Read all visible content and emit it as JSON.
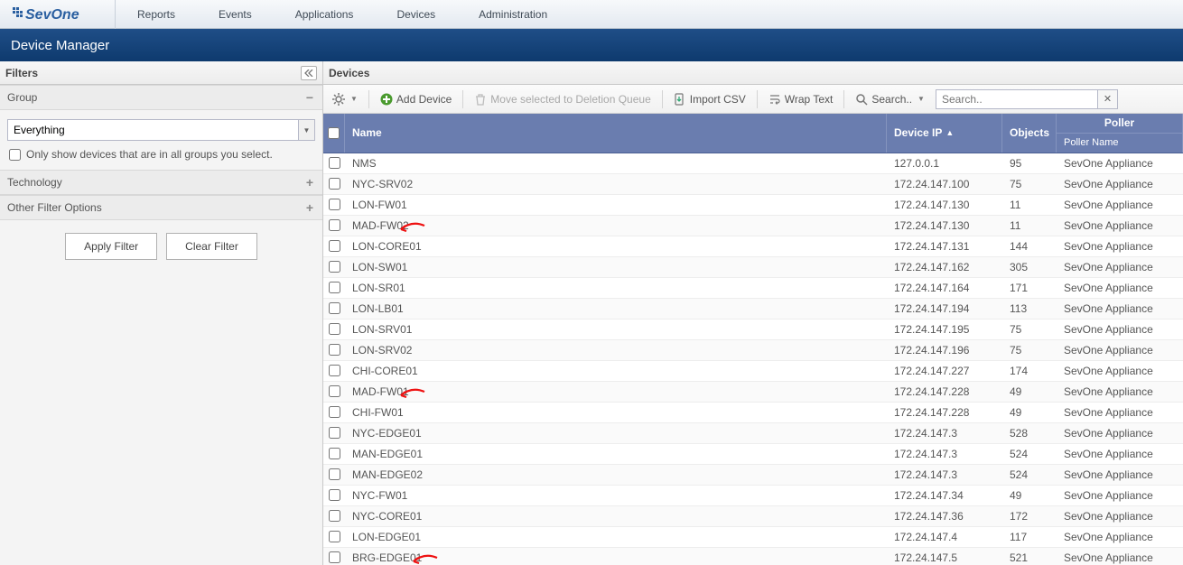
{
  "brand": "SevOne",
  "menu": {
    "items": [
      "Reports",
      "Events",
      "Applications",
      "Devices",
      "Administration"
    ]
  },
  "page_title": "Device Manager",
  "sidebar": {
    "title": "Filters",
    "sections": {
      "group": {
        "label": "Group",
        "combo_value": "Everything",
        "only_in_all_label": "Only show devices that are in all groups you select."
      },
      "technology": {
        "label": "Technology"
      },
      "other": {
        "label": "Other Filter Options"
      }
    },
    "apply_label": "Apply Filter",
    "clear_label": "Clear Filter"
  },
  "main": {
    "title": "Devices",
    "toolbar": {
      "add_device": "Add Device",
      "move_deletion": "Move selected to Deletion Queue",
      "import_csv": "Import CSV",
      "wrap_text": "Wrap Text",
      "search_label": "Search..",
      "search_placeholder": "Search.."
    },
    "columns": {
      "name": "Name",
      "device_ip": "Device IP",
      "objects": "Objects",
      "poller_group": "Poller",
      "poller_name": "Poller Name"
    },
    "rows": [
      {
        "name": "NMS",
        "ip": "127.0.0.1",
        "objects": "95",
        "poller": "SevOne Appliance",
        "annot": false
      },
      {
        "name": "NYC-SRV02",
        "ip": "172.24.147.100",
        "objects": "75",
        "poller": "SevOne Appliance",
        "annot": false
      },
      {
        "name": "LON-FW01",
        "ip": "172.24.147.130",
        "objects": "11",
        "poller": "SevOne Appliance",
        "annot": false
      },
      {
        "name": "MAD-FW02",
        "ip": "172.24.147.130",
        "objects": "11",
        "poller": "SevOne Appliance",
        "annot": true
      },
      {
        "name": "LON-CORE01",
        "ip": "172.24.147.131",
        "objects": "144",
        "poller": "SevOne Appliance",
        "annot": false
      },
      {
        "name": "LON-SW01",
        "ip": "172.24.147.162",
        "objects": "305",
        "poller": "SevOne Appliance",
        "annot": false
      },
      {
        "name": "LON-SR01",
        "ip": "172.24.147.164",
        "objects": "171",
        "poller": "SevOne Appliance",
        "annot": false
      },
      {
        "name": "LON-LB01",
        "ip": "172.24.147.194",
        "objects": "113",
        "poller": "SevOne Appliance",
        "annot": false
      },
      {
        "name": "LON-SRV01",
        "ip": "172.24.147.195",
        "objects": "75",
        "poller": "SevOne Appliance",
        "annot": false
      },
      {
        "name": "LON-SRV02",
        "ip": "172.24.147.196",
        "objects": "75",
        "poller": "SevOne Appliance",
        "annot": false
      },
      {
        "name": "CHI-CORE01",
        "ip": "172.24.147.227",
        "objects": "174",
        "poller": "SevOne Appliance",
        "annot": false
      },
      {
        "name": "MAD-FW01",
        "ip": "172.24.147.228",
        "objects": "49",
        "poller": "SevOne Appliance",
        "annot": true
      },
      {
        "name": "CHI-FW01",
        "ip": "172.24.147.228",
        "objects": "49",
        "poller": "SevOne Appliance",
        "annot": false
      },
      {
        "name": "NYC-EDGE01",
        "ip": "172.24.147.3",
        "objects": "528",
        "poller": "SevOne Appliance",
        "annot": false
      },
      {
        "name": "MAN-EDGE01",
        "ip": "172.24.147.3",
        "objects": "524",
        "poller": "SevOne Appliance",
        "annot": false
      },
      {
        "name": "MAN-EDGE02",
        "ip": "172.24.147.3",
        "objects": "524",
        "poller": "SevOne Appliance",
        "annot": false
      },
      {
        "name": "NYC-FW01",
        "ip": "172.24.147.34",
        "objects": "49",
        "poller": "SevOne Appliance",
        "annot": false
      },
      {
        "name": "NYC-CORE01",
        "ip": "172.24.147.36",
        "objects": "172",
        "poller": "SevOne Appliance",
        "annot": false
      },
      {
        "name": "LON-EDGE01",
        "ip": "172.24.147.4",
        "objects": "117",
        "poller": "SevOne Appliance",
        "annot": false
      },
      {
        "name": "BRG-EDGE01",
        "ip": "172.24.147.5",
        "objects": "521",
        "poller": "SevOne Appliance",
        "annot": true
      }
    ]
  },
  "annotation_color": "#e11"
}
